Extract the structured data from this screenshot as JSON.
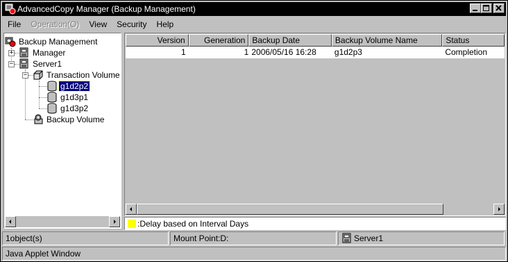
{
  "window": {
    "title": "AdvancedCopy Manager (Backup Management)"
  },
  "menu": [
    {
      "label": "File",
      "enabled": true
    },
    {
      "label": "Operation(O)",
      "enabled": false
    },
    {
      "label": "View",
      "enabled": true
    },
    {
      "label": "Security",
      "enabled": true
    },
    {
      "label": "Help",
      "enabled": true
    }
  ],
  "tree": {
    "root": "Backup Management",
    "manager": "Manager",
    "server": "Server1",
    "transaction_volume": "Transaction Volume",
    "volumes": [
      "g1d2p2",
      "g1d3p1",
      "g1d3p2"
    ],
    "selected_volume": "g1d2p2",
    "backup_volume": "Backup Volume"
  },
  "table": {
    "columns": [
      "Version",
      "Generation",
      "Backup Date",
      "Backup Volume Name",
      "Status"
    ],
    "rows": [
      {
        "version": "1",
        "generation": "1",
        "backup_date": "2006/05/16 16:28",
        "backup_volume_name": "g1d2p3",
        "status": "Completion"
      }
    ]
  },
  "legend": {
    "text": ":Delay based on Interval Days",
    "color": "#ffff00"
  },
  "status": {
    "objects": "1object(s)",
    "mount_point": "Mount Point:D:",
    "server": "Server1"
  },
  "applet_bar": "Java Applet Window",
  "colors": {
    "selection": "#000080",
    "face": "#c0c0c0",
    "titlebar": "#000000"
  }
}
